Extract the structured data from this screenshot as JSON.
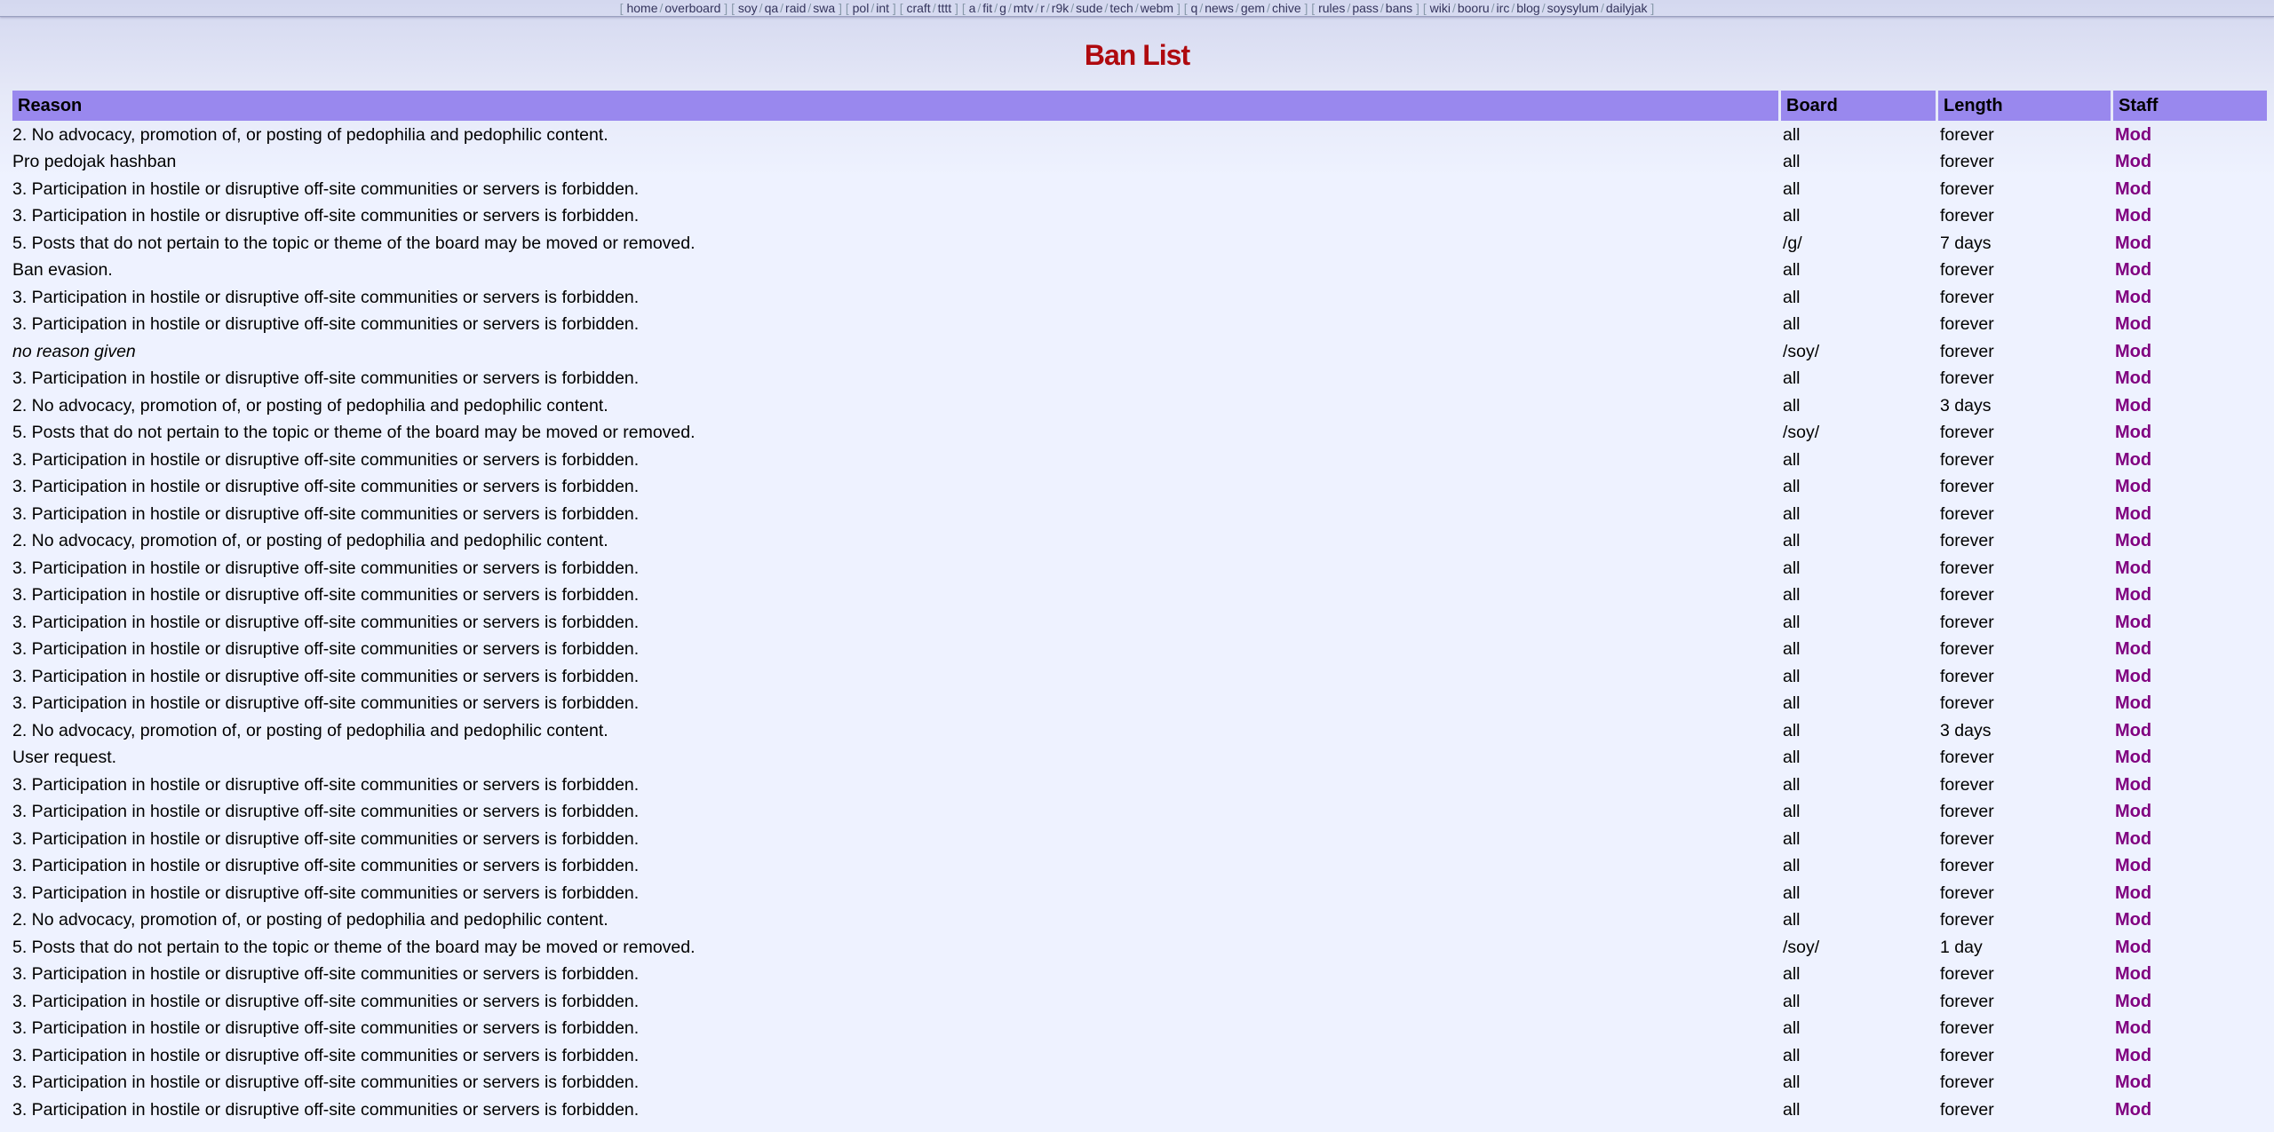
{
  "nav": {
    "groups": [
      [
        "home",
        "overboard"
      ],
      [
        "soy",
        "qa",
        "raid",
        "swa"
      ],
      [
        "pol",
        "int"
      ],
      [
        "craft",
        "tttt"
      ],
      [
        "a",
        "fit",
        "g",
        "mtv",
        "r",
        "r9k",
        "sude",
        "tech",
        "webm"
      ],
      [
        "q",
        "news",
        "gem",
        "chive"
      ],
      [
        "rules",
        "pass",
        "bans"
      ],
      [
        "wiki",
        "booru",
        "irc",
        "blog",
        "soysylum",
        "dailyjak"
      ]
    ]
  },
  "page": {
    "title": "Ban List"
  },
  "table": {
    "headers": {
      "reason": "Reason",
      "board": "Board",
      "length": "Length",
      "staff": "Staff"
    },
    "rows": [
      {
        "reason": "2. No advocacy, promotion of, or posting of pedophilia and pedophilic content.",
        "board": "all",
        "length": "forever",
        "staff": "Mod"
      },
      {
        "reason": "Pro pedojak hashban",
        "board": "all",
        "length": "forever",
        "staff": "Mod"
      },
      {
        "reason": "3. Participation in hostile or disruptive off-site communities or servers is forbidden.",
        "board": "all",
        "length": "forever",
        "staff": "Mod"
      },
      {
        "reason": "3. Participation in hostile or disruptive off-site communities or servers is forbidden.",
        "board": "all",
        "length": "forever",
        "staff": "Mod"
      },
      {
        "reason": "5. Posts that do not pertain to the topic or theme of the board may be moved or removed.",
        "board": "/g/",
        "length": "7 days",
        "staff": "Mod"
      },
      {
        "reason": "Ban evasion.",
        "board": "all",
        "length": "forever",
        "staff": "Mod"
      },
      {
        "reason": "3. Participation in hostile or disruptive off-site communities or servers is forbidden.",
        "board": "all",
        "length": "forever",
        "staff": "Mod"
      },
      {
        "reason": "3. Participation in hostile or disruptive off-site communities or servers is forbidden.",
        "board": "all",
        "length": "forever",
        "staff": "Mod"
      },
      {
        "reason": "no reason given",
        "italic": true,
        "board": "/soy/",
        "length": "forever",
        "staff": "Mod"
      },
      {
        "reason": "3. Participation in hostile or disruptive off-site communities or servers is forbidden.",
        "board": "all",
        "length": "forever",
        "staff": "Mod"
      },
      {
        "reason": "2. No advocacy, promotion of, or posting of pedophilia and pedophilic content.",
        "board": "all",
        "length": "3 days",
        "staff": "Mod"
      },
      {
        "reason": "5. Posts that do not pertain to the topic or theme of the board may be moved or removed.",
        "board": "/soy/",
        "length": "forever",
        "staff": "Mod"
      },
      {
        "reason": "3. Participation in hostile or disruptive off-site communities or servers is forbidden.",
        "board": "all",
        "length": "forever",
        "staff": "Mod"
      },
      {
        "reason": "3. Participation in hostile or disruptive off-site communities or servers is forbidden.",
        "board": "all",
        "length": "forever",
        "staff": "Mod"
      },
      {
        "reason": "3. Participation in hostile or disruptive off-site communities or servers is forbidden.",
        "board": "all",
        "length": "forever",
        "staff": "Mod"
      },
      {
        "reason": "2. No advocacy, promotion of, or posting of pedophilia and pedophilic content.",
        "board": "all",
        "length": "forever",
        "staff": "Mod"
      },
      {
        "reason": "3. Participation in hostile or disruptive off-site communities or servers is forbidden.",
        "board": "all",
        "length": "forever",
        "staff": "Mod"
      },
      {
        "reason": "3. Participation in hostile or disruptive off-site communities or servers is forbidden.",
        "board": "all",
        "length": "forever",
        "staff": "Mod"
      },
      {
        "reason": "3. Participation in hostile or disruptive off-site communities or servers is forbidden.",
        "board": "all",
        "length": "forever",
        "staff": "Mod"
      },
      {
        "reason": "3. Participation in hostile or disruptive off-site communities or servers is forbidden.",
        "board": "all",
        "length": "forever",
        "staff": "Mod"
      },
      {
        "reason": "3. Participation in hostile or disruptive off-site communities or servers is forbidden.",
        "board": "all",
        "length": "forever",
        "staff": "Mod"
      },
      {
        "reason": "3. Participation in hostile or disruptive off-site communities or servers is forbidden.",
        "board": "all",
        "length": "forever",
        "staff": "Mod"
      },
      {
        "reason": "2. No advocacy, promotion of, or posting of pedophilia and pedophilic content.",
        "board": "all",
        "length": "3 days",
        "staff": "Mod"
      },
      {
        "reason": "User request.",
        "board": "all",
        "length": "forever",
        "staff": "Mod"
      },
      {
        "reason": "3. Participation in hostile or disruptive off-site communities or servers is forbidden.",
        "board": "all",
        "length": "forever",
        "staff": "Mod"
      },
      {
        "reason": "3. Participation in hostile or disruptive off-site communities or servers is forbidden.",
        "board": "all",
        "length": "forever",
        "staff": "Mod"
      },
      {
        "reason": "3. Participation in hostile or disruptive off-site communities or servers is forbidden.",
        "board": "all",
        "length": "forever",
        "staff": "Mod"
      },
      {
        "reason": "3. Participation in hostile or disruptive off-site communities or servers is forbidden.",
        "board": "all",
        "length": "forever",
        "staff": "Mod"
      },
      {
        "reason": "3. Participation in hostile or disruptive off-site communities or servers is forbidden.",
        "board": "all",
        "length": "forever",
        "staff": "Mod"
      },
      {
        "reason": "2. No advocacy, promotion of, or posting of pedophilia and pedophilic content.",
        "board": "all",
        "length": "forever",
        "staff": "Mod"
      },
      {
        "reason": "5. Posts that do not pertain to the topic or theme of the board may be moved or removed.",
        "board": "/soy/",
        "length": "1 day",
        "staff": "Mod"
      },
      {
        "reason": "3. Participation in hostile or disruptive off-site communities or servers is forbidden.",
        "board": "all",
        "length": "forever",
        "staff": "Mod"
      },
      {
        "reason": "3. Participation in hostile or disruptive off-site communities or servers is forbidden.",
        "board": "all",
        "length": "forever",
        "staff": "Mod"
      },
      {
        "reason": "3. Participation in hostile or disruptive off-site communities or servers is forbidden.",
        "board": "all",
        "length": "forever",
        "staff": "Mod"
      },
      {
        "reason": "3. Participation in hostile or disruptive off-site communities or servers is forbidden.",
        "board": "all",
        "length": "forever",
        "staff": "Mod"
      },
      {
        "reason": "3. Participation in hostile or disruptive off-site communities or servers is forbidden.",
        "board": "all",
        "length": "forever",
        "staff": "Mod"
      },
      {
        "reason": "3. Participation in hostile or disruptive off-site communities or servers is forbidden.",
        "board": "all",
        "length": "forever",
        "staff": "Mod"
      }
    ]
  },
  "colors": {
    "header_bg": "#9988ee",
    "title": "#af0a0f",
    "staff": "#800080",
    "link": "#34345c",
    "page_bg": "#eef2ff"
  }
}
